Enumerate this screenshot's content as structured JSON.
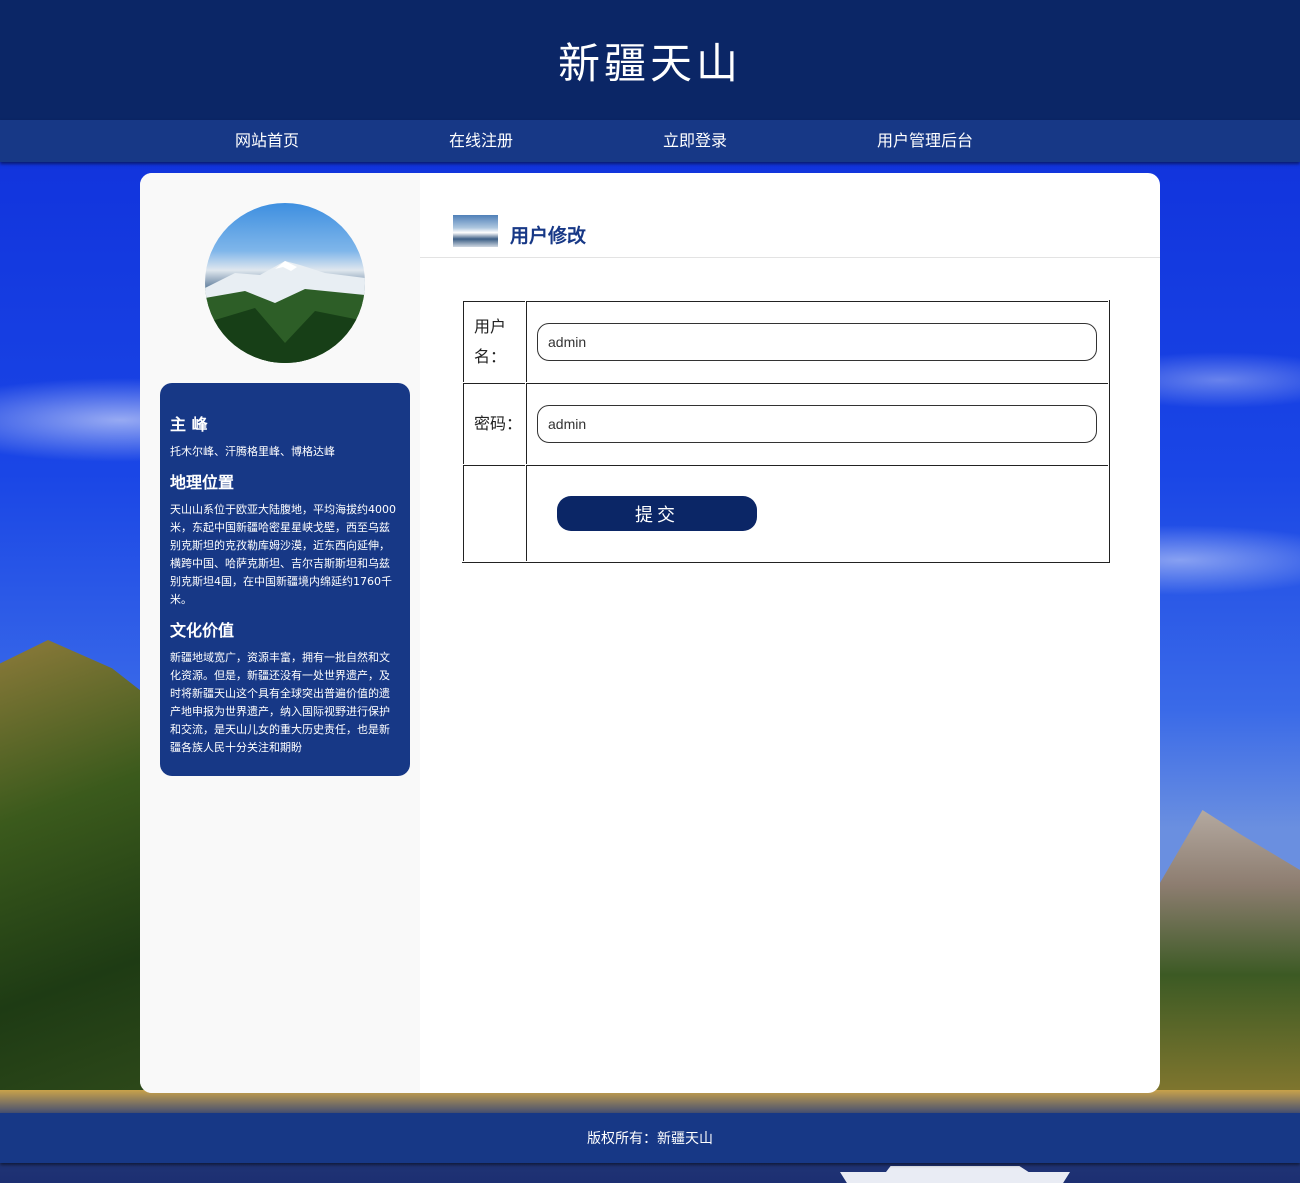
{
  "header": {
    "title": "新疆天山"
  },
  "nav": {
    "items": [
      {
        "label": "网站首页"
      },
      {
        "label": "在线注册"
      },
      {
        "label": "立即登录"
      },
      {
        "label": "用户管理后台"
      }
    ]
  },
  "sidebar": {
    "sections": [
      {
        "heading": "主 峰",
        "text": "托木尔峰、汗腾格里峰、博格达峰"
      },
      {
        "heading": "地理位置",
        "text": "天山山系位于欧亚大陆腹地，平均海拔约4000米，东起中国新疆哈密星星峡戈壁，西至乌兹别克斯坦的克孜勒库姆沙漠，近东西向延伸，横跨中国、哈萨克斯坦、吉尔吉斯斯坦和乌兹别克斯坦4国，在中国新疆境内绵延约1760千米。"
      },
      {
        "heading": "文化价值",
        "text": "新疆地域宽广，资源丰富，拥有一批自然和文化资源。但是，新疆还没有一处世界遗产，及时将新疆天山这个具有全球突出普遍价值的遗产地申报为世界遗产，纳入国际视野进行保护和交流，是天山儿女的重大历史责任，也是新疆各族人民十分关注和期盼"
      }
    ]
  },
  "content": {
    "title": "用户修改",
    "form": {
      "username_label": "用户名：",
      "username_value": "admin",
      "password_label": "密码：",
      "password_value": "admin",
      "submit_label": "提交"
    }
  },
  "footer": {
    "text": "版权所有：新疆天山"
  },
  "colors": {
    "header_bg": "#0b2666",
    "nav_bg": "#173886",
    "accent": "#173886"
  }
}
